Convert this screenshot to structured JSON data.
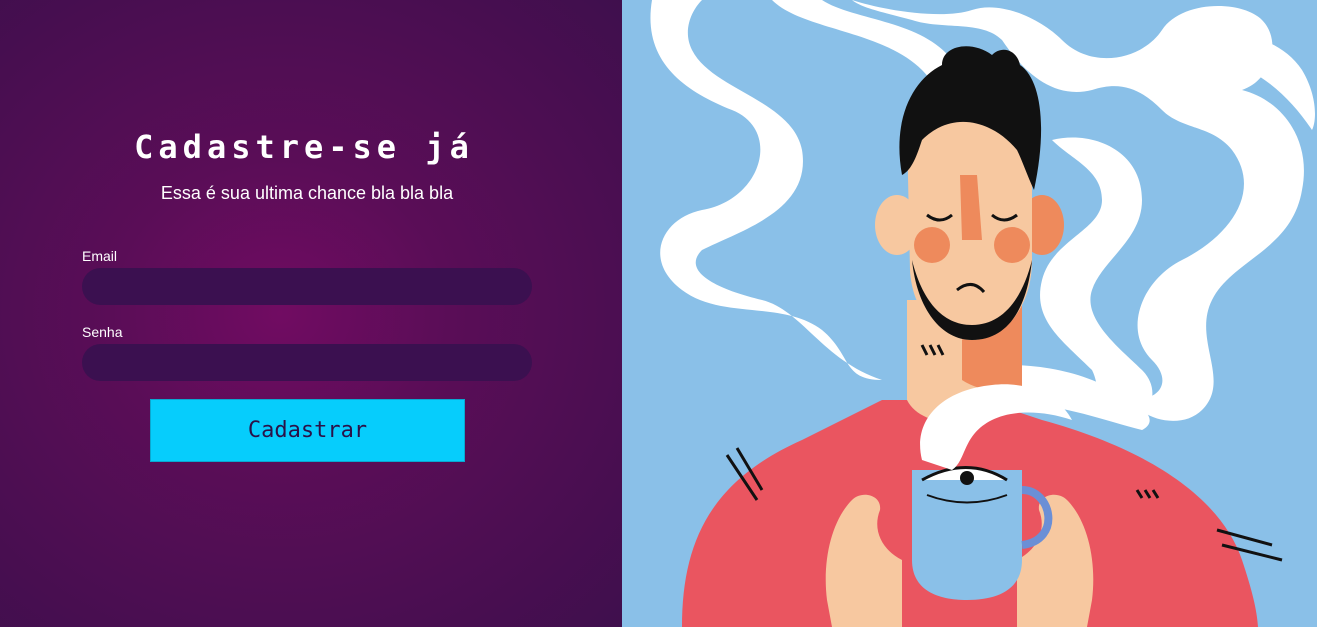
{
  "form": {
    "title": "Cadastre-se já",
    "subtitle": "Essa é sua ultima chance bla bla bla",
    "email_label": "Email",
    "email_value": "",
    "password_label": "Senha",
    "password_value": "",
    "submit_label": "Cadastrar"
  },
  "colors": {
    "panel_background": "#5a0d57",
    "input_background": "#3b1050",
    "button_background": "#06cdfc",
    "illustration_background": "#8ac0e8"
  }
}
